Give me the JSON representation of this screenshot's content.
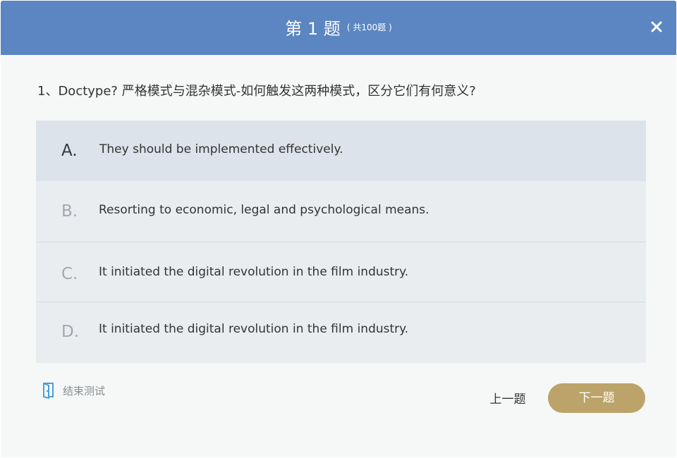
{
  "header": {
    "title": "第 1 题",
    "count": "( 共100题 )",
    "close_icon": "close-icon"
  },
  "question": {
    "text": "1、Doctype? 严格模式与混杂模式-如何触发这两种模式，区分它们有何意义?"
  },
  "options": [
    {
      "letter": "A.",
      "text": "They should be implemented effectively.",
      "selected": true
    },
    {
      "letter": "B.",
      "text": "Resorting to economic, legal and psychological means.",
      "selected": false
    },
    {
      "letter": "C.",
      "text": "It initiated the digital revolution in the film industry.",
      "selected": false
    },
    {
      "letter": "D.",
      "text": "It initiated the digital revolution in the film industry.",
      "selected": false
    }
  ],
  "footer": {
    "end_label": "结束测试",
    "end_icon": "exit-door-icon",
    "prev_label": "上一题",
    "next_label": "下一题"
  },
  "colors": {
    "header_bg": "#5b86c1",
    "accent_button": "#bca36a",
    "selected_option_bg": "#dce3ea",
    "option_bg": "#e9edf0",
    "icon_accent": "#4a9fd8"
  }
}
